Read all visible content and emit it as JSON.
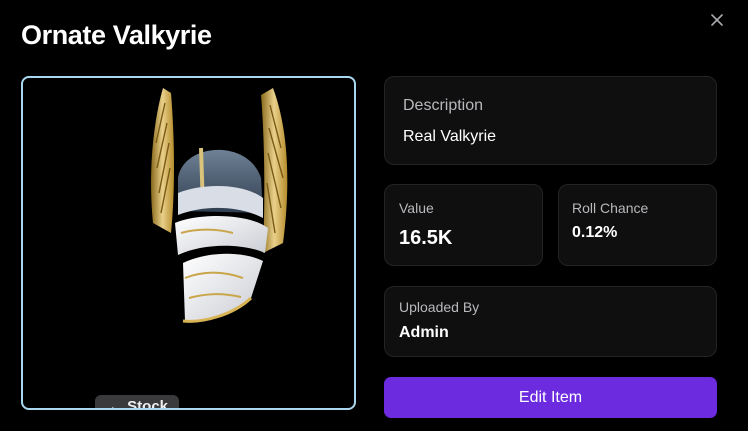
{
  "modal": {
    "title": "Ornate Valkyrie",
    "close_icon": "close-icon"
  },
  "image": {
    "icon": "valkyrie-helmet-image",
    "badge_label": "← Stock"
  },
  "description": {
    "label": "Description",
    "value": "Real Valkyrie"
  },
  "value": {
    "label": "Value",
    "value": "16.5K"
  },
  "roll_chance": {
    "label": "Roll Chance",
    "value": "0.12%"
  },
  "uploaded_by": {
    "label": "Uploaded By",
    "value": "Admin"
  },
  "actions": {
    "edit_label": "Edit Item"
  },
  "colors": {
    "accent": "#6d2be0",
    "image_border": "#a9d7ef",
    "card_bg": "#0f0f10"
  }
}
